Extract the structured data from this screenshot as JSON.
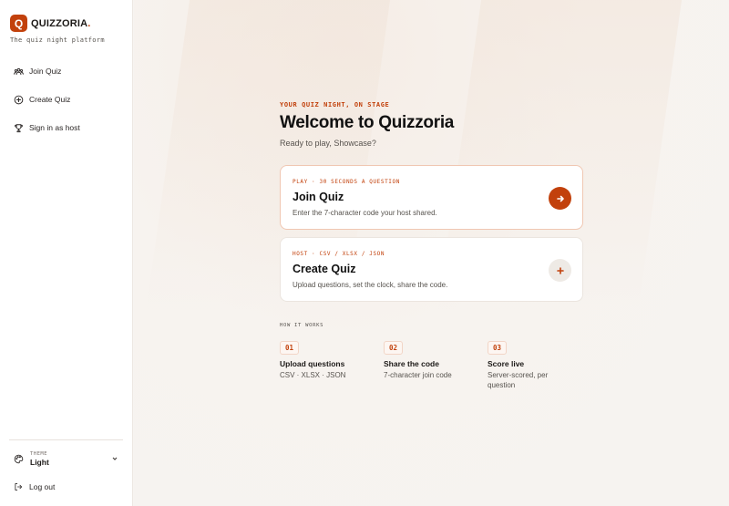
{
  "brand": {
    "logo_letter": "Q",
    "name": "QUIZZORIA",
    "dot": ".",
    "tagline": "The quiz night platform",
    "accent_color": "#c2410c"
  },
  "sidebar": {
    "items": [
      {
        "label": "Join Quiz",
        "icon": "users-icon"
      },
      {
        "label": "Create Quiz",
        "icon": "plus-circle-icon"
      },
      {
        "label": "Sign in as host",
        "icon": "trophy-icon"
      }
    ],
    "theme": {
      "caption": "THEME",
      "value": "Light",
      "icon": "palette-icon"
    },
    "logout": {
      "label": "Log out",
      "icon": "logout-icon"
    }
  },
  "hero": {
    "eyebrow": "YOUR QUIZ NIGHT, ON STAGE",
    "title": "Welcome to Quizzoria",
    "subtitle": "Ready to play, Showcase?"
  },
  "cards": [
    {
      "kicker": "PLAY · 30 SECONDS A QUESTION",
      "title": "Join Quiz",
      "description": "Enter the 7-character code your host shared.",
      "action_icon": "arrow-right-icon"
    },
    {
      "kicker": "HOST · CSV / XLSX / JSON",
      "title": "Create Quiz",
      "description": "Upload questions, set the clock, share the code.",
      "action_icon": "plus-icon"
    }
  ],
  "how_it_works": {
    "label": "HOW IT WORKS",
    "steps": [
      {
        "number": "01",
        "title": "Upload questions",
        "description": "CSV · XLSX · JSON"
      },
      {
        "number": "02",
        "title": "Share the code",
        "description": "7-character join code"
      },
      {
        "number": "03",
        "title": "Score live",
        "description": "Server-scored, per question"
      }
    ]
  }
}
